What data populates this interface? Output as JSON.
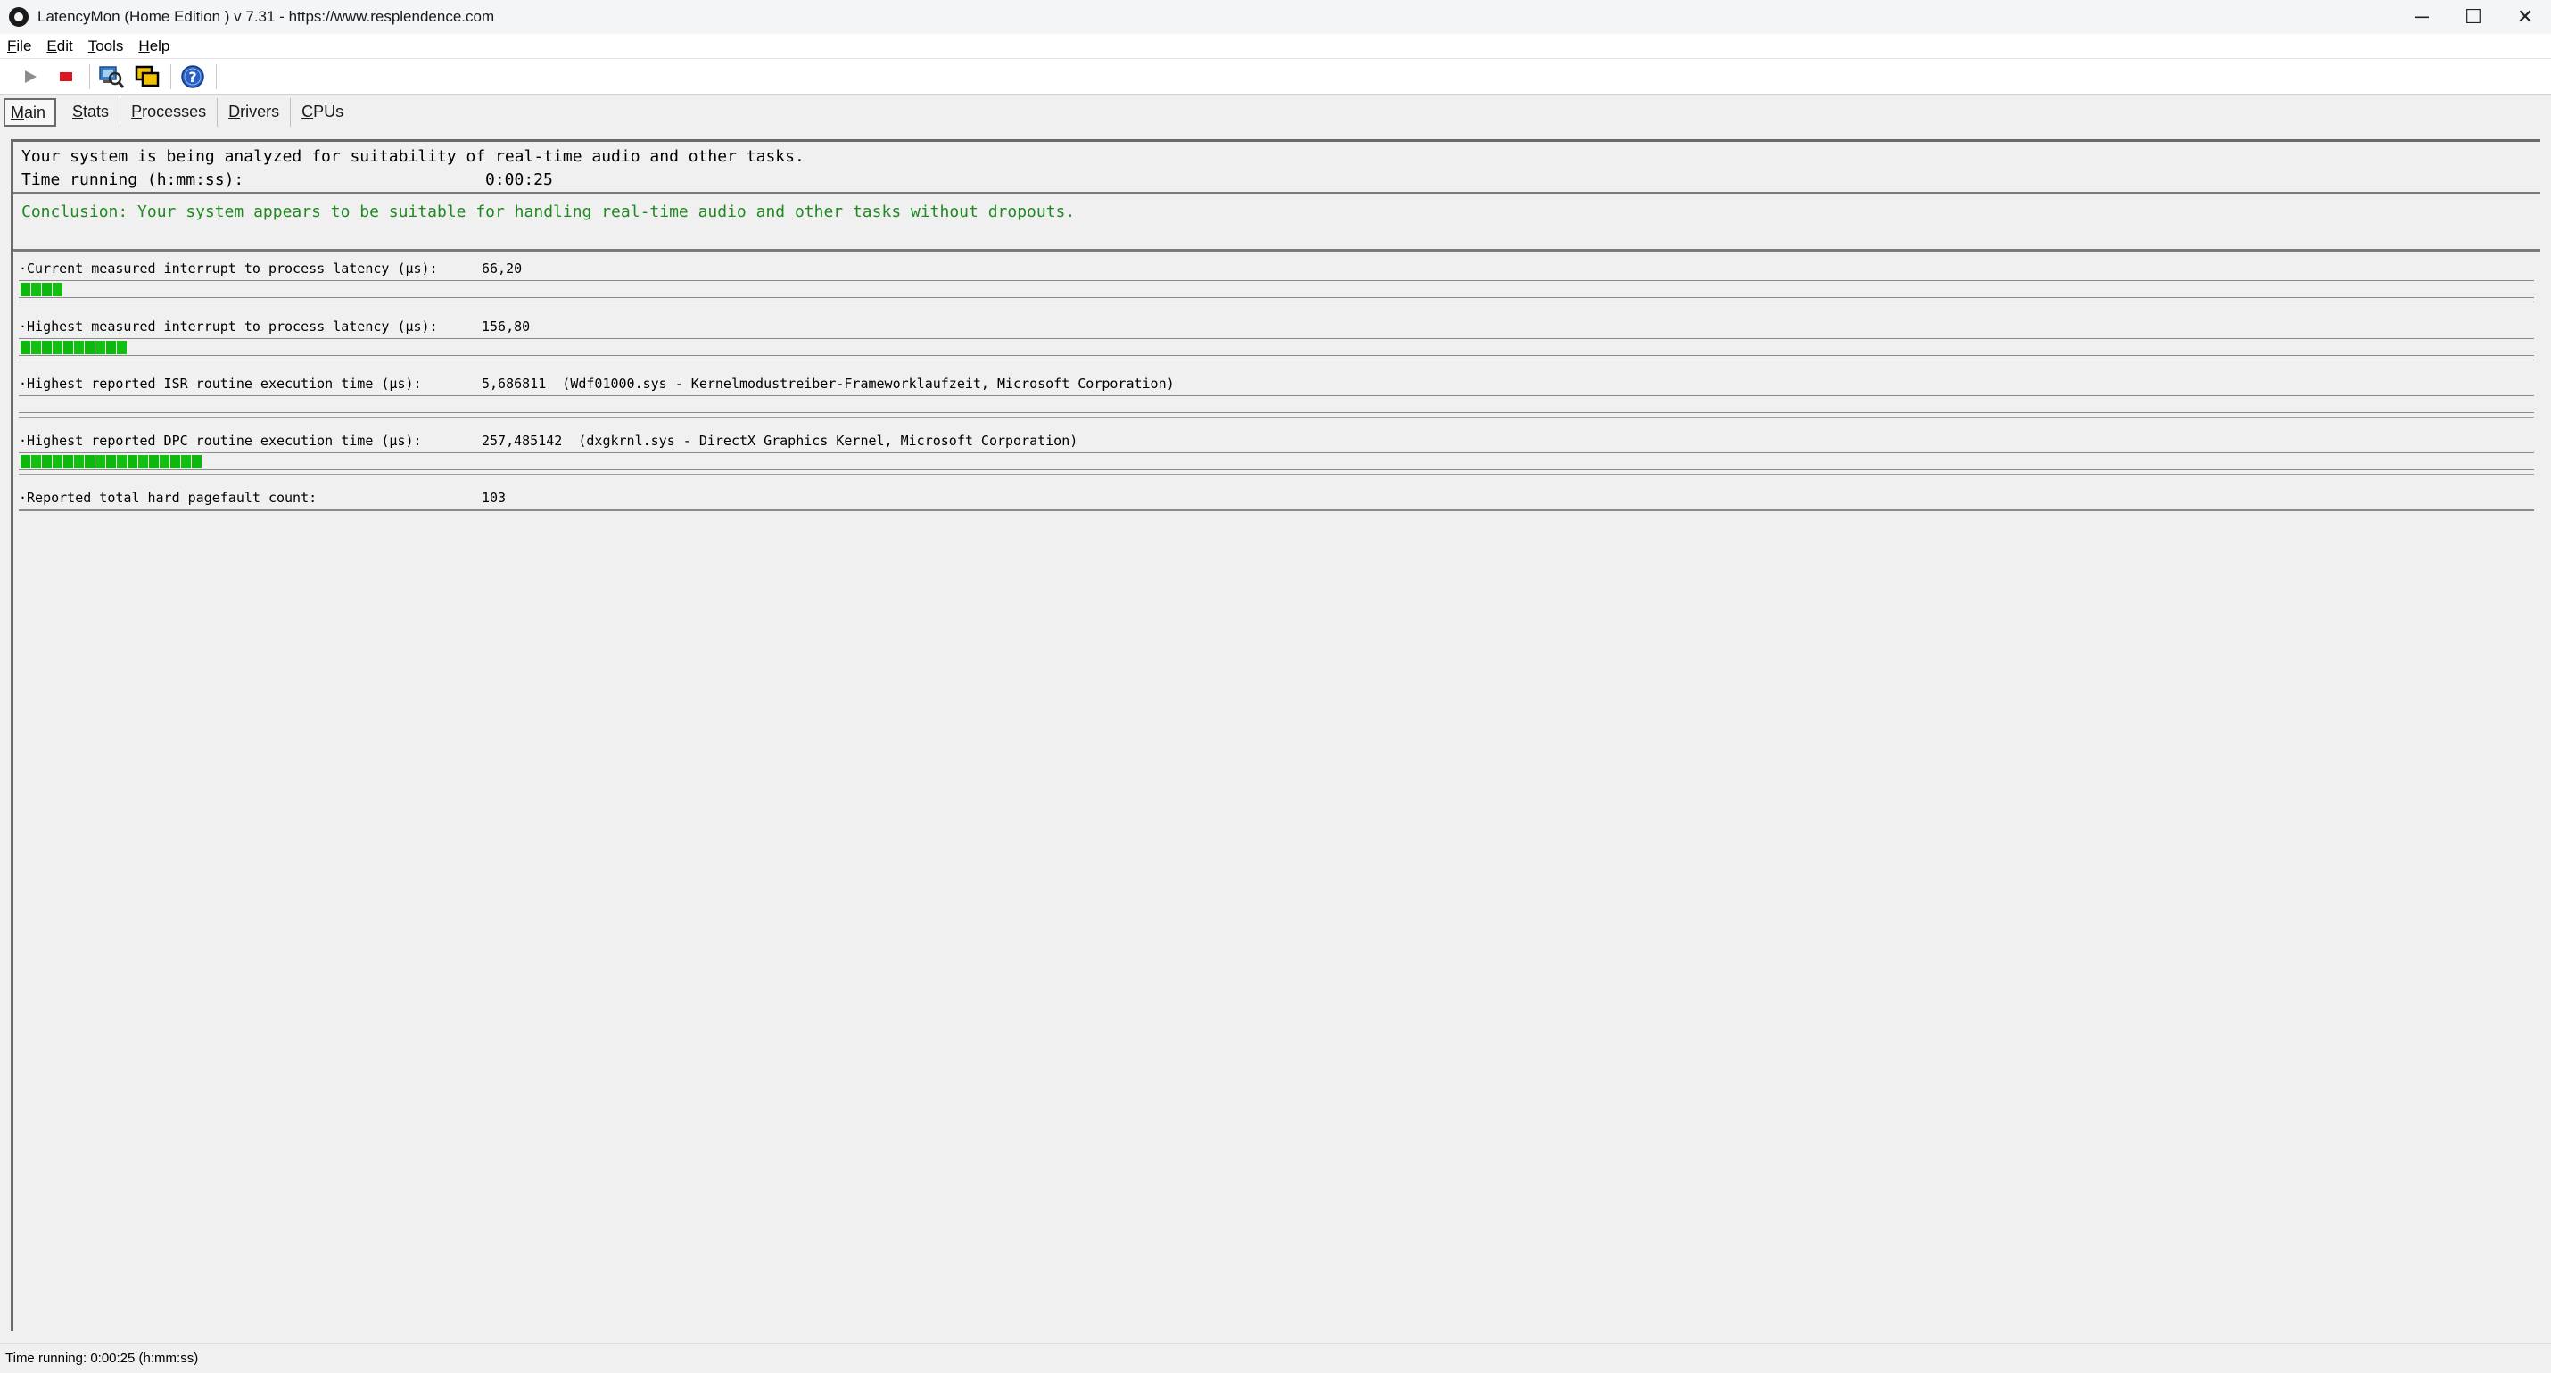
{
  "window": {
    "title": "LatencyMon  (Home Edition )  v 7.31 - https://www.resplendence.com",
    "minimize_glyph": "─",
    "maximize_glyph": "☐",
    "close_glyph": "✕"
  },
  "menu": {
    "file": {
      "mn": "F",
      "rest": "ile"
    },
    "edit": {
      "mn": "E",
      "rest": "dit"
    },
    "tools": {
      "mn": "T",
      "rest": "ools"
    },
    "help": {
      "mn": "H",
      "rest": "elp"
    }
  },
  "toolbar": {
    "icons": [
      "play-icon",
      "stop-icon",
      "driver-search-icon",
      "windows-icon",
      "help-icon"
    ]
  },
  "tabs": [
    {
      "mn": "M",
      "rest": "ain"
    },
    {
      "mn": "S",
      "rest": "tats"
    },
    {
      "mn": "P",
      "rest": "rocesses"
    },
    {
      "mn": "D",
      "rest": "rivers"
    },
    {
      "mn": "C",
      "rest": "PUs"
    }
  ],
  "analysis": {
    "line1": "Your system is being analyzed for suitability of real-time audio and other tasks.",
    "time_label": "Time running (h:mm:ss):",
    "time_value": "0:00:25",
    "conclusion": "Conclusion: Your system appears to be suitable for handling real-time audio and other tasks without dropouts."
  },
  "metrics": [
    {
      "label": "·Current measured interrupt to process latency (µs):",
      "value": "66,20",
      "bar_segments": 4
    },
    {
      "label": "·Highest measured interrupt to process latency (µs):",
      "value": "156,80",
      "bar_segments": 10
    },
    {
      "label": "·Highest reported ISR routine execution time (µs):",
      "value": "5,686811  (Wdf01000.sys - Kernelmodustreiber-Frameworklaufzeit, Microsoft Corporation)",
      "bar_segments": 0
    },
    {
      "label": "·Highest reported DPC routine execution time (µs):",
      "value": "257,485142  (dxgkrnl.sys - DirectX Graphics Kernel, Microsoft Corporation)",
      "bar_segments": 17
    },
    {
      "label": "·Reported total hard pagefault count:",
      "value": "103",
      "bar_segments": 0
    }
  ],
  "colors": {
    "bar_green": "#12c012",
    "conclusion_green": "#1f8a1f"
  },
  "status": {
    "text": "Time running: 0:00:25  (h:mm:ss)"
  }
}
